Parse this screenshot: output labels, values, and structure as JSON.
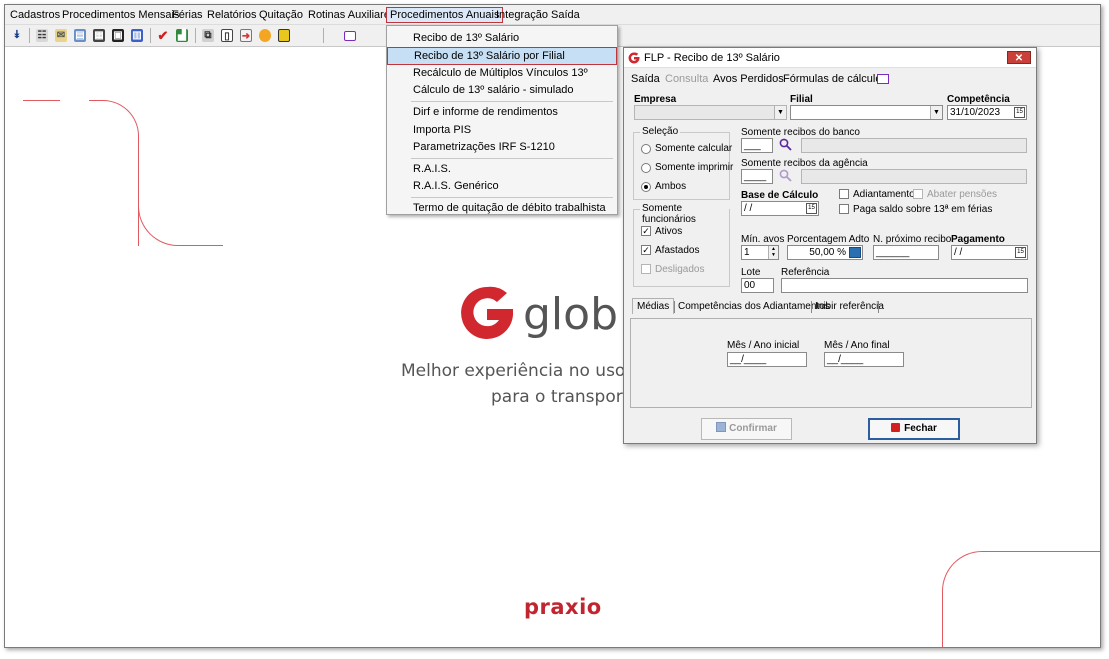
{
  "menubar": {
    "items": [
      "Cadastros",
      "Procedimentos Mensais",
      "Férias",
      "Relatórios",
      "Quitação",
      "Rotinas Auxiliares",
      "Procedimentos Anuais",
      "Integração",
      "Saída"
    ]
  },
  "annual_menu": {
    "items": [
      "Recibo de 13º Salário",
      "Recibo de 13º Salário por Filial",
      "Recálculo de Múltiplos Vínculos 13º",
      "Cálculo de 13º salário - simulado",
      "Dirf e informe de rendimentos",
      "Importa PIS",
      "Parametrizações IRF S-1210",
      "R.A.I.S.",
      "R.A.I.S. Genérico",
      "Termo de quitação de débito trabalhista"
    ],
    "highlighted": "Recibo de 13º Salário por Filial"
  },
  "background": {
    "logo_text": "glob",
    "tagline_line1": "Melhor experiência no uso d",
    "tagline_line2": "para o transporte",
    "brand": "praxio",
    "brand_color": "#c1252f"
  },
  "dialog": {
    "title": "FLP - Recibo de 13º Salário",
    "close_icon": "close-icon",
    "menu": [
      "Saída",
      "Consulta",
      "Avos Perdidos",
      "Fórmulas de cálculos"
    ],
    "empresa_label": "Empresa",
    "filial_label": "Filial",
    "competencia_label": "Competência",
    "competencia_value": "31/10/2023",
    "selecao_label": "Seleção",
    "selecao_options": [
      "Somente calcular",
      "Somente imprimir",
      "Ambos"
    ],
    "selecao_selected": "Ambos",
    "banco_label": "Somente recibos do banco",
    "banco_value": "___",
    "agencia_label": "Somente recibos da agência",
    "agencia_value": "____",
    "base_calculo_label": "Base de Cálculo",
    "base_calculo_value": " / /",
    "adiantamento_label": "Adiantamento",
    "abater_pensoes_label": "Abater pensões",
    "paga_saldo_label": "Paga saldo sobre 13ª em férias",
    "funcionarios_label": "Somente funcionários",
    "funcionarios": [
      {
        "label": "Ativos",
        "checked": true
      },
      {
        "label": "Afastados",
        "checked": true
      },
      {
        "label": "Desligados",
        "checked": false
      }
    ],
    "min_avos_label": "Mín. avos",
    "min_avos_value": "1",
    "porcentagem_label": "Porcentagem Adto",
    "porcentagem_value": "50,00 %",
    "n_proximo_label": "N. próximo recibo",
    "n_proximo_value": "______",
    "pagamento_label": "Pagamento",
    "pagamento_value": " / /",
    "lote_label": "Lote",
    "lote_value": "00",
    "referencia_label": "Referência",
    "tabs": [
      "Médias",
      "Competências dos Adiantamentos",
      "Inibir referência"
    ],
    "mes_inicial_label": "Mês / Ano inicial",
    "mes_inicial_value": "__/____",
    "mes_final_label": "Mês / Ano final",
    "mes_final_value": "__/____",
    "confirmar_label": "Confirmar",
    "fechar_label": "Fechar"
  },
  "colors": {
    "accent_red": "#c0353c",
    "highlight": "#c7dff5",
    "arrow": "#e02020"
  }
}
